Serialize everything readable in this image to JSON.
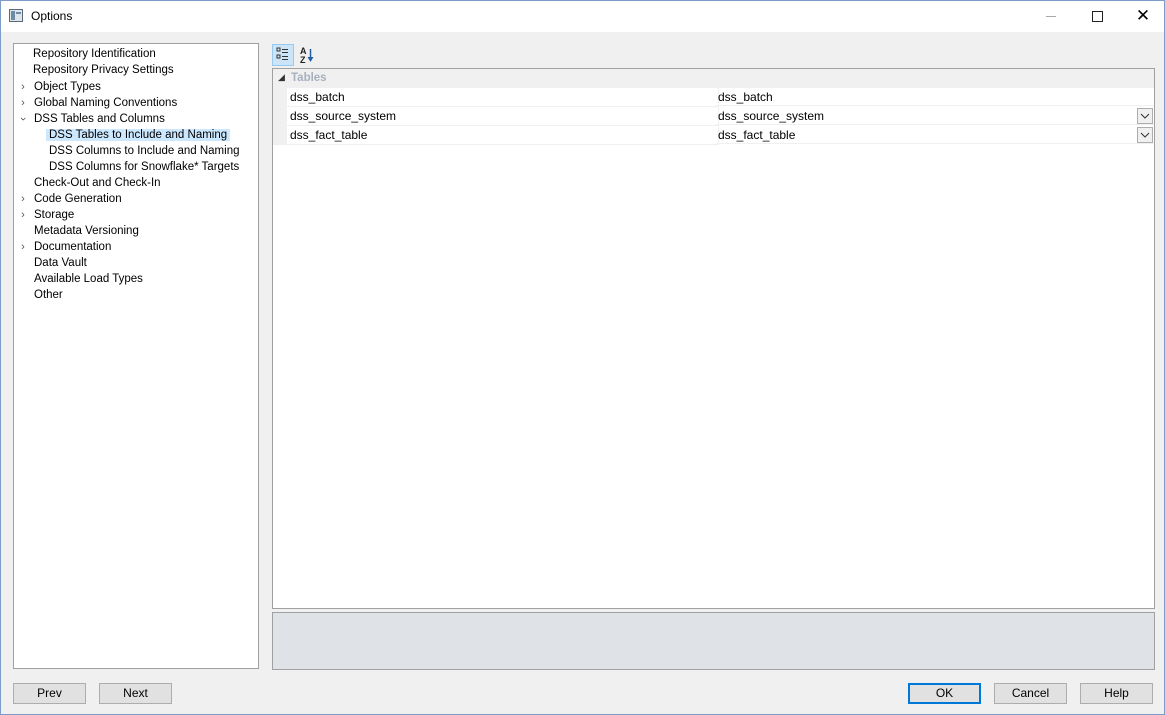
{
  "window": {
    "title": "Options"
  },
  "tree": {
    "items": [
      {
        "label": "Repository Identification",
        "expander": false
      },
      {
        "label": "Repository Privacy Settings",
        "expander": false
      },
      {
        "label": "Object Types",
        "expander": "collapsed"
      },
      {
        "label": "Global Naming Conventions",
        "expander": "collapsed"
      },
      {
        "label": "DSS Tables and Columns",
        "expander": "expanded"
      },
      {
        "label": "DSS Tables to Include and Naming",
        "expander": false,
        "selected": true
      },
      {
        "label": "DSS Columns to Include and Naming",
        "expander": false
      },
      {
        "label": "DSS Columns for Snowflake* Targets",
        "expander": false
      },
      {
        "label": "Check-Out and Check-In",
        "expander": false
      },
      {
        "label": "Code Generation",
        "expander": "collapsed"
      },
      {
        "label": "Storage",
        "expander": "collapsed"
      },
      {
        "label": "Metadata Versioning",
        "expander": false
      },
      {
        "label": "Documentation",
        "expander": "collapsed"
      },
      {
        "label": "Data Vault",
        "expander": false
      },
      {
        "label": "Available Load Types",
        "expander": false
      },
      {
        "label": "Other",
        "expander": false
      }
    ]
  },
  "toolbar": {
    "categorized_icon": "categorized-view-icon",
    "alphabetical_icon": "sort-az-icon"
  },
  "grid": {
    "category": "Tables",
    "rows": [
      {
        "name": "dss_batch",
        "value": "dss_batch",
        "dropdown": false
      },
      {
        "name": "dss_source_system",
        "value": "dss_source_system",
        "dropdown": true
      },
      {
        "name": "dss_fact_table",
        "value": "dss_fact_table",
        "dropdown": true
      }
    ]
  },
  "buttons": {
    "prev": "Prev",
    "next": "Next",
    "ok": "OK",
    "cancel": "Cancel",
    "help": "Help"
  },
  "colors": {
    "selection": "#cce8ff",
    "default_button_border": "#0078d7",
    "category_text": "#a8b0c0"
  }
}
